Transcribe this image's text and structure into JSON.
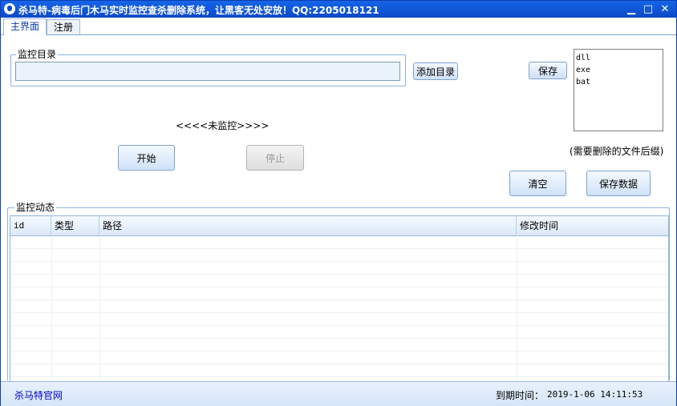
{
  "window": {
    "title": "杀马特-病毒后门木马实时监控查杀删除系统，让黑客无处安放！QQ:2205018121",
    "minimize": "▁",
    "maximize": "□",
    "close": "✕"
  },
  "tabs": [
    {
      "label": "主界面",
      "active": true
    },
    {
      "label": "注册",
      "active": false
    }
  ],
  "monitor_dir": {
    "group_label": "监控目录",
    "input_value": "",
    "add_button": "添加目录"
  },
  "extensions": {
    "save_button": "保存",
    "items": [
      "dll",
      "exe",
      "bat"
    ],
    "hint": "(需要删除的文件后缀)"
  },
  "status_text": "<<<<未监控>>>>",
  "controls": {
    "start_button": "开始",
    "stop_button": "停止",
    "clear_button": "清空",
    "save_data_button": "保存数据"
  },
  "activity": {
    "group_label": "监控动态",
    "columns": [
      "id",
      "类型",
      "路径",
      "修改时间"
    ],
    "rows": []
  },
  "statusbar": {
    "site_link": "杀马特官网",
    "expire_label": "到期时间：",
    "expire_value": "2019-1-06 14:11:53"
  }
}
